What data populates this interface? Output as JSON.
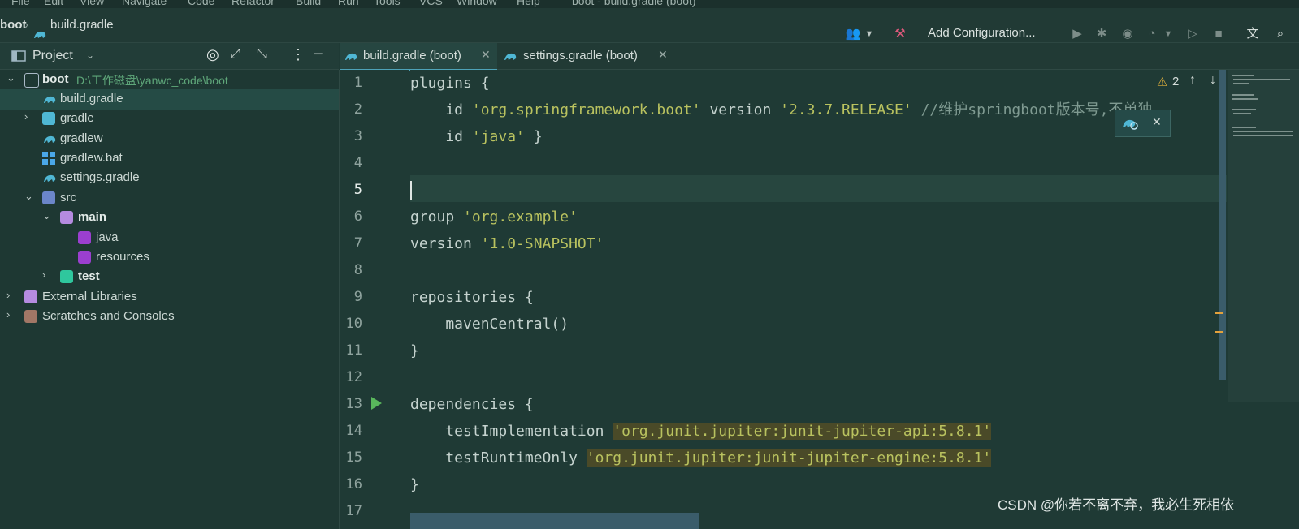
{
  "menu": {
    "items": [
      "File",
      "Edit",
      "View",
      "Navigate",
      "Code",
      "Refactor",
      "Build",
      "Run",
      "Tools",
      "VCS",
      "Window",
      "Help"
    ],
    "window_title": "boot - build.gradle (boot)"
  },
  "navbar": {
    "breadcrumb_project": "boot",
    "breadcrumb_file": "build.gradle",
    "add_config_label": "Add Configuration..."
  },
  "project_panel": {
    "title": "Project",
    "tree": [
      {
        "label": "boot",
        "path": "D:\\工作磁盘\\yanwc_code\\boot",
        "bold": true,
        "expanded": true,
        "depth": 0,
        "icon": "folder-icon"
      },
      {
        "label": "build.gradle",
        "depth": 1,
        "icon": "gradle-icon",
        "selected": true
      },
      {
        "label": "gradle",
        "depth": 1,
        "icon": "gradle-folder-icon",
        "collapsed": true
      },
      {
        "label": "gradlew",
        "depth": 1,
        "icon": "gradle-icon"
      },
      {
        "label": "gradlew.bat",
        "depth": 1,
        "icon": "windows-icon"
      },
      {
        "label": "settings.gradle",
        "depth": 1,
        "icon": "gradle-icon"
      },
      {
        "label": "src",
        "depth": 1,
        "icon": "src-folder-icon",
        "expanded": true
      },
      {
        "label": "main",
        "depth": 2,
        "icon": "main-folder-icon",
        "bold": true,
        "expanded": true
      },
      {
        "label": "java",
        "depth": 3,
        "icon": "java-folder-icon"
      },
      {
        "label": "resources",
        "depth": 3,
        "icon": "resources-folder-icon"
      },
      {
        "label": "test",
        "depth": 2,
        "icon": "test-folder-icon",
        "bold": true,
        "collapsed": true
      },
      {
        "label": "External Libraries",
        "depth": 0,
        "icon": "libraries-icon",
        "collapsed": true
      },
      {
        "label": "Scratches and Consoles",
        "depth": 0,
        "icon": "scratches-icon",
        "collapsed": true
      }
    ]
  },
  "tabs": [
    {
      "label": "build.gradle (boot)",
      "active": true
    },
    {
      "label": "settings.gradle (boot)",
      "active": false
    }
  ],
  "editor": {
    "current_line": 5,
    "warnings_count": "2",
    "lines": [
      {
        "n": "1",
        "code": "plugins {"
      },
      {
        "n": "2",
        "code": "    id 'org.springframework.boot' version '2.3.7.RELEASE' //维护springboot版本号,不单独"
      },
      {
        "n": "3",
        "code": "    id 'java' }"
      },
      {
        "n": "4",
        "code": ""
      },
      {
        "n": "5",
        "code": ""
      },
      {
        "n": "6",
        "code": "group 'org.example'"
      },
      {
        "n": "7",
        "code": "version '1.0-SNAPSHOT'"
      },
      {
        "n": "8",
        "code": ""
      },
      {
        "n": "9",
        "code": "repositories {"
      },
      {
        "n": "10",
        "code": "    mavenCentral()"
      },
      {
        "n": "11",
        "code": "}"
      },
      {
        "n": "12",
        "code": ""
      },
      {
        "n": "13",
        "code": "dependencies {"
      },
      {
        "n": "14",
        "code": "    testImplementation 'org.junit.jupiter:junit-jupiter-api:5.8.1'"
      },
      {
        "n": "15",
        "code": "    testRuntimeOnly 'org.junit.jupiter:junit-jupiter-engine:5.8.1'"
      },
      {
        "n": "16",
        "code": "}"
      },
      {
        "n": "17",
        "code": ""
      }
    ]
  },
  "watermark": "CSDN @你若不离不弃，我必生死相依",
  "colors": {
    "accent": "#4ea3b8",
    "string": "#b9c25f",
    "run_gutter": "#59b75c",
    "gradle": "#4fb7d4"
  }
}
